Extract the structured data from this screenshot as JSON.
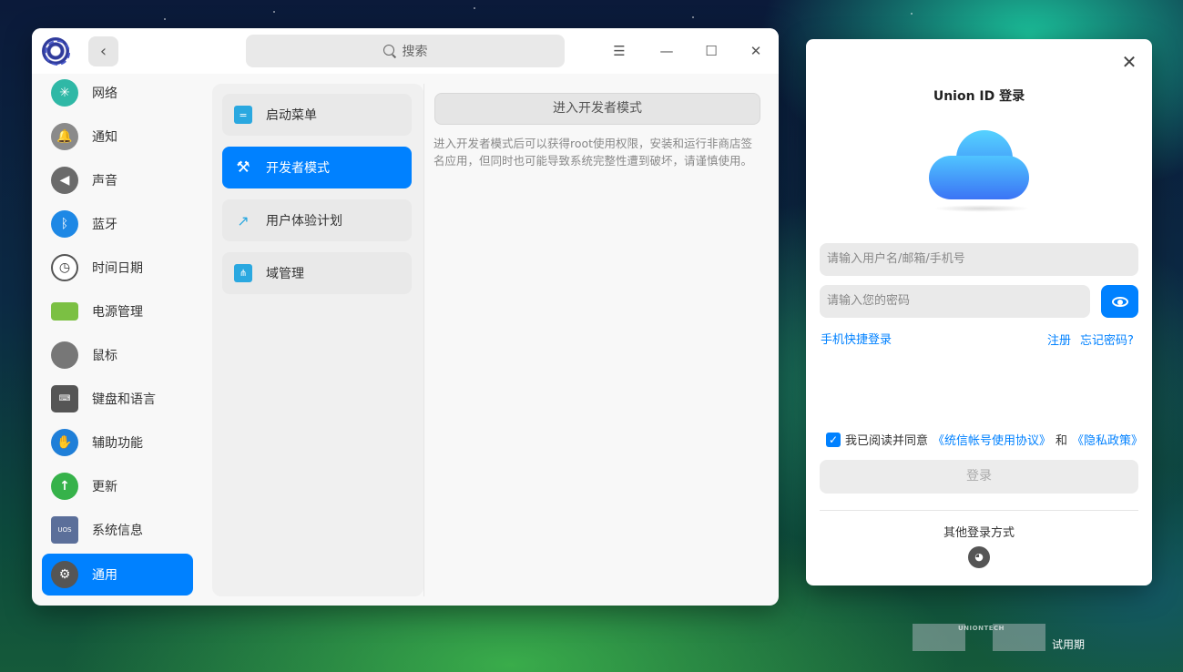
{
  "control_center": {
    "search_placeholder": "搜索",
    "window_buttons": {
      "menu": "☰",
      "minimize": "—",
      "maximize": "☐",
      "close": "✕"
    },
    "sidebar": {
      "items": [
        {
          "label": "网络",
          "icon": "network-icon",
          "color": "#2fb8a6"
        },
        {
          "label": "通知",
          "icon": "bell-icon",
          "color": "#8a8a8a"
        },
        {
          "label": "声音",
          "icon": "speaker-icon",
          "color": "#6b6b6b"
        },
        {
          "label": "蓝牙",
          "icon": "bluetooth-icon",
          "color": "#1e88e5"
        },
        {
          "label": "时间日期",
          "icon": "clock-icon",
          "color": "#d9d9d9"
        },
        {
          "label": "电源管理",
          "icon": "battery-icon",
          "color": "#7bc043"
        },
        {
          "label": "鼠标",
          "icon": "mouse-icon",
          "color": "#777777"
        },
        {
          "label": "键盘和语言",
          "icon": "keyboard-icon",
          "color": "#555555"
        },
        {
          "label": "辅助功能",
          "icon": "accessibility-icon",
          "color": "#1f7fd8"
        },
        {
          "label": "更新",
          "icon": "update-arrow-icon",
          "color": "#36b24a"
        },
        {
          "label": "系统信息",
          "icon": "system-info-icon",
          "color": "#5b6f9a"
        },
        {
          "label": "通用",
          "icon": "gear-icon",
          "color": "#555555"
        }
      ],
      "active_index": 11
    },
    "general_menu": {
      "items": [
        {
          "label": "启动菜单",
          "icon": "boot-menu-icon"
        },
        {
          "label": "开发者模式",
          "icon": "tools-icon"
        },
        {
          "label": "用户体验计划",
          "icon": "chart-trend-icon"
        },
        {
          "label": "域管理",
          "icon": "domain-icon"
        }
      ],
      "active_index": 1
    },
    "developer": {
      "button_label": "进入开发者模式",
      "description": "进入开发者模式后可以获得root使用权限，安装和运行非商店签名应用，但同时也可能导致系统完整性遭到破坏，请谨慎使用。"
    }
  },
  "login_dialog": {
    "title": "Union ID 登录",
    "username_placeholder": "请输入用户名/邮箱/手机号",
    "password_placeholder": "请输入您的密码",
    "phone_login": "手机快捷登录",
    "register": "注册",
    "forgot_password": "忘记密码?",
    "agree_prefix": "我已阅读并同意",
    "agreement_link": "《统信帐号使用协议》",
    "agree_and": "和",
    "privacy_link": "《隐私政策》",
    "agreement_checked": true,
    "login_button": "登录",
    "other_methods": "其他登录方式",
    "accent_color": "#0081ff"
  },
  "watermark": {
    "brand": "UNIONTECH",
    "trial": "试用期"
  }
}
